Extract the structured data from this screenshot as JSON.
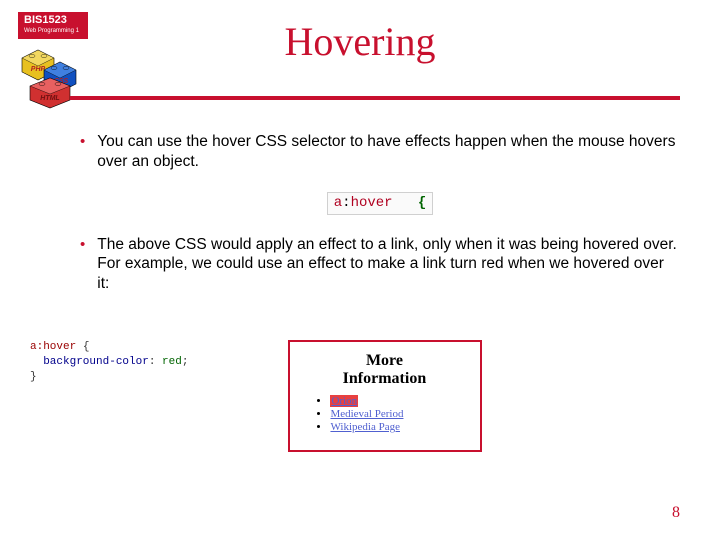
{
  "logo": {
    "course": "BIS1523",
    "subtitle": "Web Programming 1"
  },
  "title": "Hovering",
  "bullets": {
    "b1": "You can use the hover CSS selector to have effects happen when the mouse hovers over an object.",
    "b2": "The above CSS would apply an effect to a link, only when it was being hovered over.  For example, we could use an effect to make a link turn red when we hovered over it:"
  },
  "inline_code": {
    "selector": "a",
    "colon": ":",
    "pseudo": "hover",
    "brace": "{"
  },
  "code_block": {
    "line1_sel": "a:hover",
    "line1_brace": " {",
    "line2_prop": "  background-color",
    "line2_colon": ": ",
    "line2_val": "red",
    "line2_semi": ";",
    "line3": "}"
  },
  "preview": {
    "title_line1": "More",
    "title_line2": "Information",
    "items": {
      "i1": "Orion",
      "i2": "Medieval Period",
      "i3": "Wikipedia Page"
    }
  },
  "page_number": "8",
  "block_labels": {
    "php": "PHP",
    "css": "CSS",
    "html": "HTML"
  }
}
